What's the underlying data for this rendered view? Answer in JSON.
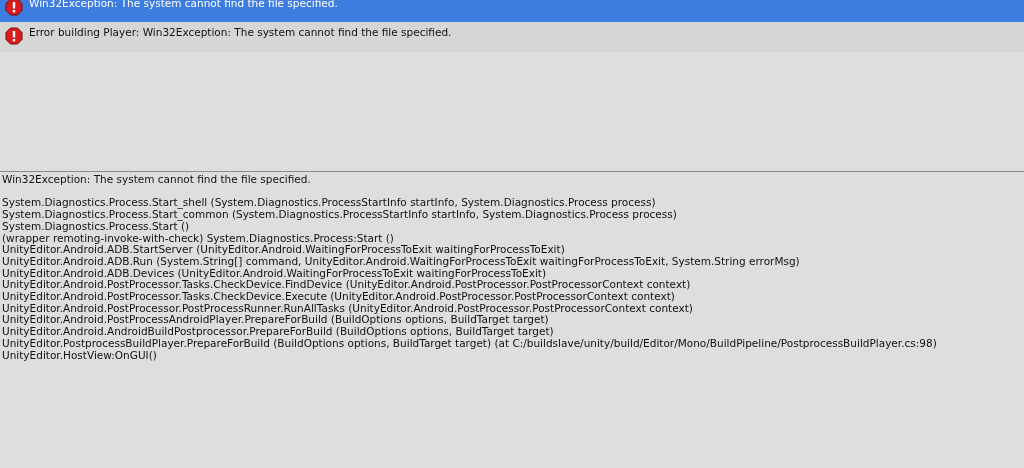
{
  "entries": [
    {
      "message": "Win32Exception: The system cannot find the file specified.",
      "selected": true
    },
    {
      "message": "Error building Player: Win32Exception: The system cannot find the file specified.",
      "selected": false
    }
  ],
  "detail": {
    "message": "Win32Exception: The system cannot find the file specified.",
    "stack": [
      "System.Diagnostics.Process.Start_shell (System.Diagnostics.ProcessStartInfo startInfo, System.Diagnostics.Process process)",
      "System.Diagnostics.Process.Start_common (System.Diagnostics.ProcessStartInfo startInfo, System.Diagnostics.Process process)",
      "System.Diagnostics.Process.Start ()",
      "(wrapper remoting-invoke-with-check) System.Diagnostics.Process:Start ()",
      "UnityEditor.Android.ADB.StartServer (UnityEditor.Android.WaitingForProcessToExit waitingForProcessToExit)",
      "UnityEditor.Android.ADB.Run (System.String[] command, UnityEditor.Android.WaitingForProcessToExit waitingForProcessToExit, System.String errorMsg)",
      "UnityEditor.Android.ADB.Devices (UnityEditor.Android.WaitingForProcessToExit waitingForProcessToExit)",
      "UnityEditor.Android.PostProcessor.Tasks.CheckDevice.FindDevice (UnityEditor.Android.PostProcessor.PostProcessorContext context)",
      "UnityEditor.Android.PostProcessor.Tasks.CheckDevice.Execute (UnityEditor.Android.PostProcessor.PostProcessorContext context)",
      "UnityEditor.Android.PostProcessor.PostProcessRunner.RunAllTasks (UnityEditor.Android.PostProcessor.PostProcessorContext context)",
      "UnityEditor.Android.PostProcessAndroidPlayer.PrepareForBuild (BuildOptions options, BuildTarget target)",
      "UnityEditor.Android.AndroidBuildPostprocessor.PrepareForBuild (BuildOptions options, BuildTarget target)",
      "UnityEditor.PostprocessBuildPlayer.PrepareForBuild (BuildOptions options, BuildTarget target) (at C:/buildslave/unity/build/Editor/Mono/BuildPipeline/PostprocessBuildPlayer.cs:98)",
      "UnityEditor.HostView:OnGUI()"
    ]
  }
}
